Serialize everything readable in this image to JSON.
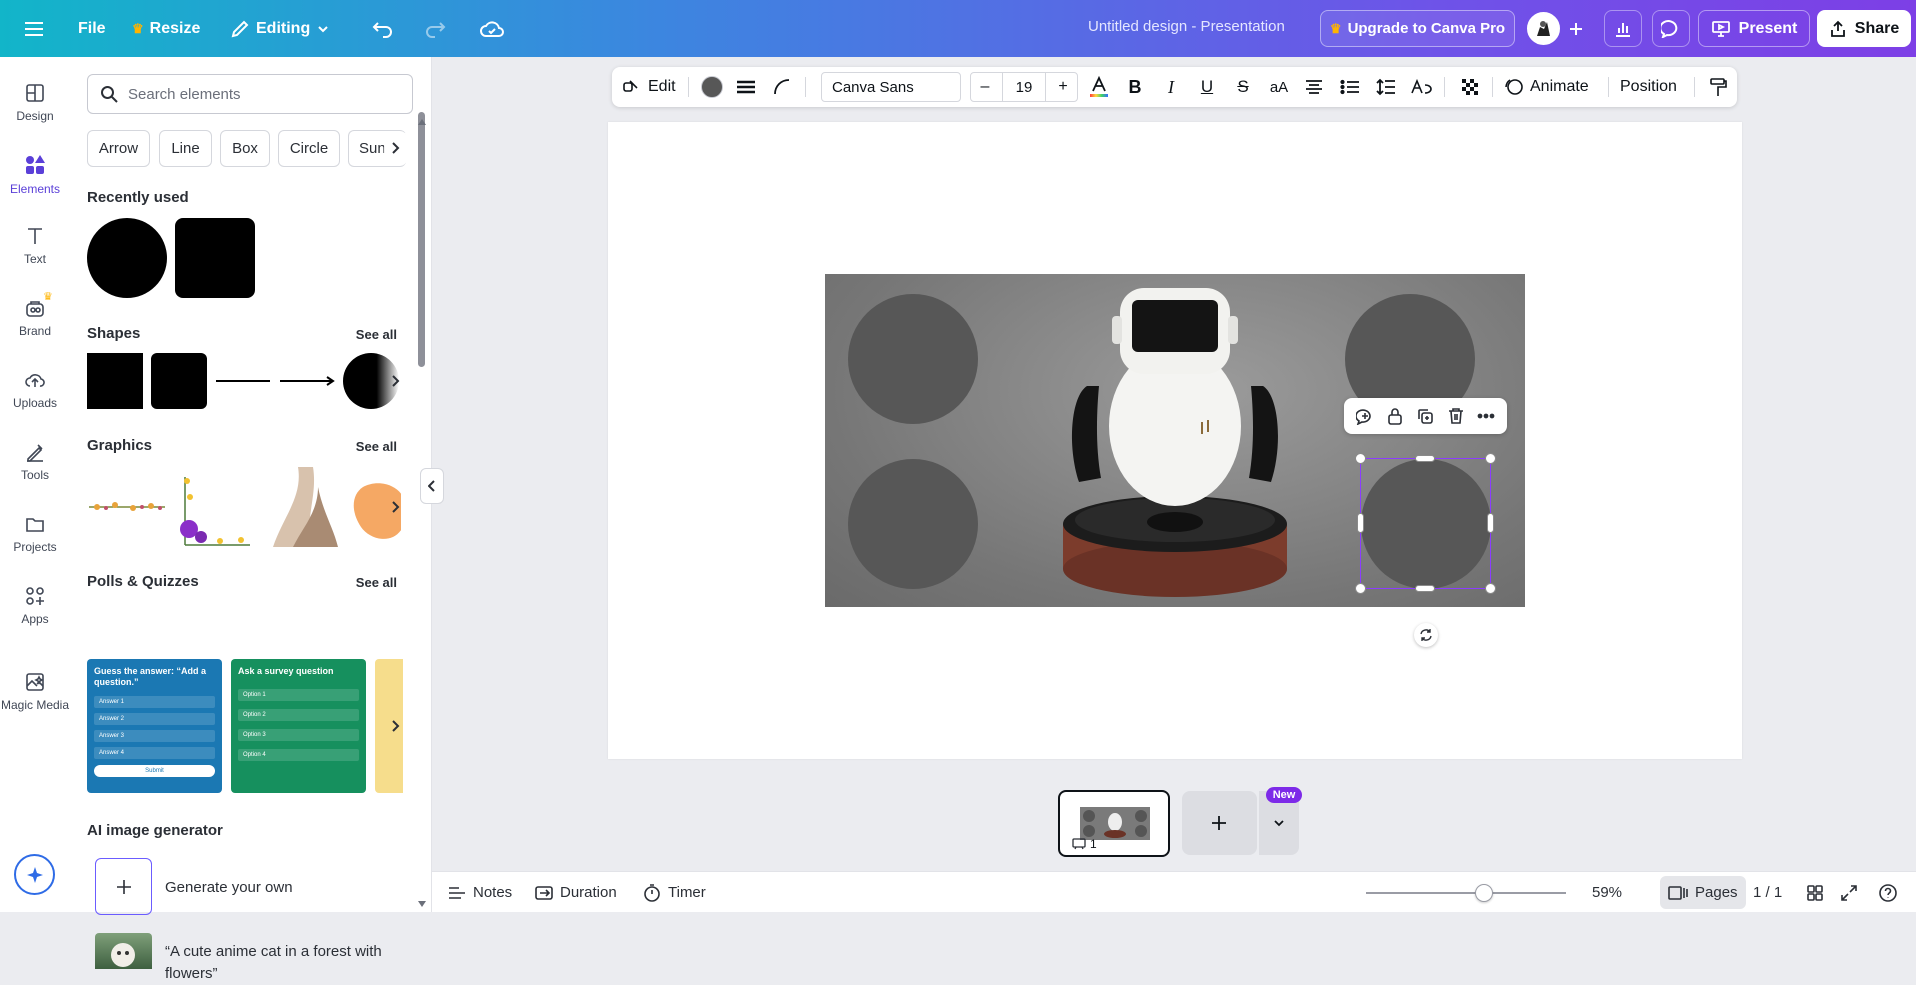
{
  "topbar": {
    "menu_icon": "hamburger-menu-icon",
    "file": "File",
    "resize": "Resize",
    "editing": "Editing",
    "title": "Untitled design - Presentation",
    "upgrade": "Upgrade to Canva Pro",
    "present": "Present",
    "share": "Share"
  },
  "rail": {
    "items": [
      {
        "label": "Design",
        "icon": "design-icon"
      },
      {
        "label": "Elements",
        "icon": "elements-icon"
      },
      {
        "label": "Text",
        "icon": "text-icon"
      },
      {
        "label": "Brand",
        "icon": "brand-icon"
      },
      {
        "label": "Uploads",
        "icon": "uploads-icon"
      },
      {
        "label": "Tools",
        "icon": "tools-icon"
      },
      {
        "label": "Projects",
        "icon": "projects-icon"
      },
      {
        "label": "Apps",
        "icon": "apps-icon"
      },
      {
        "label": "Magic Media",
        "icon": "magic-media-icon"
      }
    ]
  },
  "panel": {
    "search_placeholder": "Search elements",
    "chips": [
      "Arrow",
      "Line",
      "Box",
      "Circle",
      "Sun"
    ],
    "recently_used": "Recently used",
    "shapes": "Shapes",
    "graphics": "Graphics",
    "polls": "Polls & Quizzes",
    "see_all": "See all",
    "ai_generator": "AI image generator",
    "generate_own": "Generate your own",
    "ai_prompt": "“A cute anime cat in a forest with flowers”",
    "poll_cards": [
      {
        "question": "Guess the answer: “Add a question.”",
        "options": [
          "Answer 1",
          "Answer 2",
          "Answer 3",
          "Answer 4"
        ],
        "button": "Submit"
      },
      {
        "question": "Ask a survey question",
        "options": [
          "Option 1",
          "Option 2",
          "Option 3",
          "Option 4"
        ],
        "button": ""
      }
    ]
  },
  "toolbar": {
    "edit": "Edit",
    "font": "Canva Sans",
    "font_size": "19",
    "minus": "–",
    "plus": "+",
    "animate": "Animate",
    "position": "Position"
  },
  "bottom": {
    "notes": "Notes",
    "duration": "Duration",
    "timer": "Timer",
    "zoom": "59%",
    "zoom_fraction": 0.59,
    "pages": "Pages",
    "page_count": "1 / 1",
    "page_number": "1",
    "new_badge": "New"
  },
  "colors": {
    "accent": "#8b3dff",
    "active": "#5a3fd8",
    "shape_fill": "#575757"
  }
}
